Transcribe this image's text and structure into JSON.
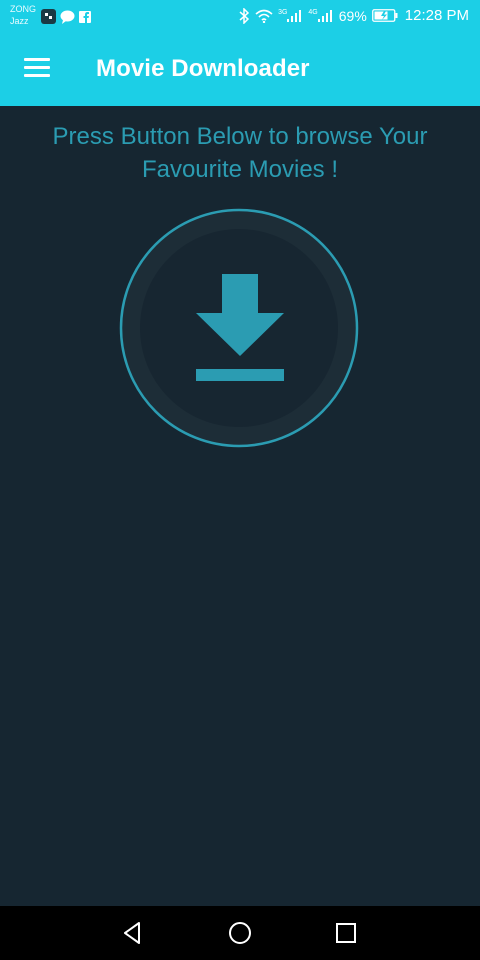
{
  "status_bar": {
    "carrier_line1": "ZONG",
    "carrier_line2": "Jazz",
    "signal_1_label": "3G",
    "signal_2_label": "4G",
    "battery_percent": "69%",
    "time": "12:28 PM",
    "icons": [
      "app-notification-icon",
      "message-icon",
      "facebook-icon",
      "bluetooth-icon",
      "wifi-icon",
      "signal-icon",
      "battery-icon"
    ]
  },
  "toolbar": {
    "title": "Movie Downloader",
    "menu_icon": "menu-icon"
  },
  "main": {
    "instruction_line1": "Press Button Below to browse Your",
    "instruction_line2": "Favourite Movies !",
    "download_icon": "download-icon"
  },
  "nav_bar": {
    "icons": [
      "back-icon",
      "home-icon",
      "recents-icon"
    ]
  },
  "colors": {
    "header": "#1ccfe6",
    "background": "#162631",
    "accent": "#2b9cb2",
    "circle_outer": "#1d2d37",
    "circle_inner": "#172631",
    "nav_bar": "#000000"
  }
}
